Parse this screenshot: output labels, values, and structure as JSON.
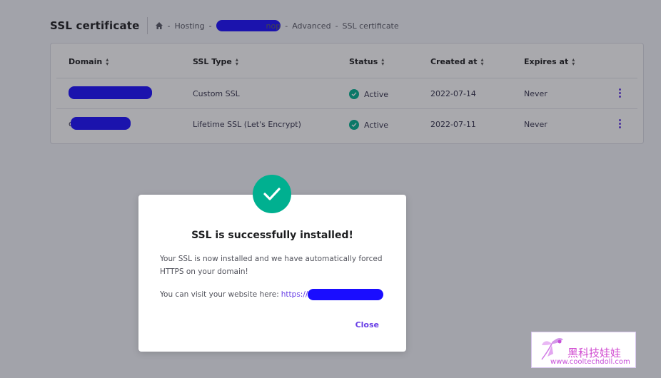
{
  "header": {
    "title": "SSL certificate",
    "breadcrumb": {
      "hosting": "Hosting",
      "site_suffix": "nop",
      "advanced": "Advanced",
      "current": "SSL certificate",
      "separator": "-"
    }
  },
  "table": {
    "columns": [
      "Domain",
      "SSL Type",
      "Status",
      "Created at",
      "Expires at"
    ],
    "rows": [
      {
        "domain_prefix": "",
        "domain_suffix": "",
        "ssl_type": "Custom SSL",
        "status": "Active",
        "created_at": "2022-07-14",
        "expires_at": "Never"
      },
      {
        "domain_prefix": "c",
        "domain_suffix": "",
        "ssl_type": "Lifetime SSL (Let's Encrypt)",
        "status": "Active",
        "created_at": "2022-07-11",
        "expires_at": "Never"
      }
    ]
  },
  "modal": {
    "title": "SSL is successfully installed!",
    "message": "Your SSL is now installed and we have automatically forced HTTPS on your domain!",
    "visit_text": "You can visit your website here:",
    "link_prefix": "https://",
    "close_label": "Close"
  },
  "watermark": {
    "chinese_text": "黑科技娃娃",
    "url": "www.cooltechdoll.com"
  },
  "colors": {
    "accent": "#673de6",
    "success": "#00b090",
    "redaction": "#1a0dff"
  },
  "icons": {
    "home": "home-icon",
    "sort": "sort-icon",
    "status": "check-circle-icon",
    "menu": "kebab-menu-icon",
    "success": "checkmark-icon"
  }
}
